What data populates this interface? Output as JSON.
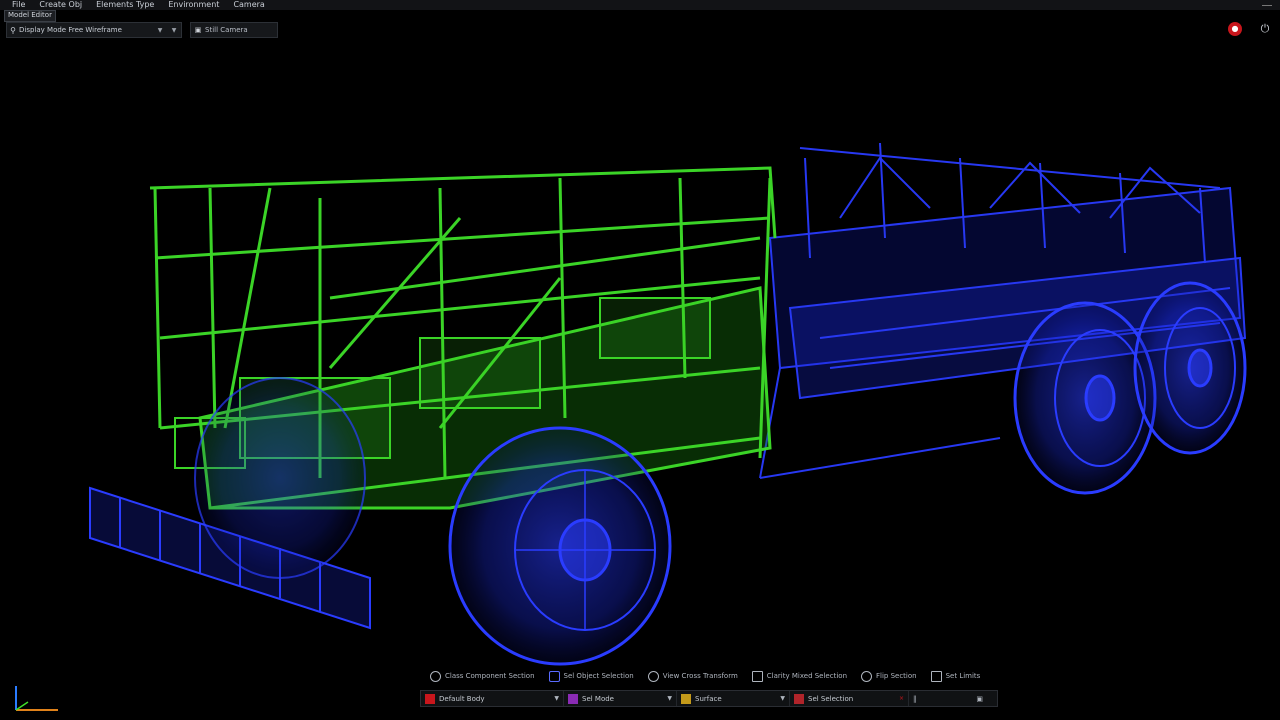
{
  "menubar": {
    "items": [
      "File",
      "Create Obj",
      "Elements Type",
      "Environment",
      "Camera"
    ]
  },
  "doc_tab": {
    "label": "Model Editor"
  },
  "toolbar": {
    "search_dropdown": "Display Mode Free Wireframe",
    "view_button": "Still Camera"
  },
  "colors": {
    "frame_green": "#3fe02a",
    "chassis_blue": "#2a3cff",
    "background": "#000000",
    "record_red": "#c8161c"
  },
  "mode_row": [
    {
      "icon": "circle-icon",
      "label": "Class Component Section"
    },
    {
      "icon": "layers-icon",
      "label": "Sel Object Selection"
    },
    {
      "icon": "circle-icon",
      "label": "View Cross Transform"
    },
    {
      "icon": "cube-icon",
      "label": "Clarity Mixed Selection"
    },
    {
      "icon": "circle-icon",
      "label": "Flip Section"
    },
    {
      "icon": "square-icon",
      "label": "Set Limits"
    }
  ],
  "bottom_bar": [
    {
      "label": "Default Body",
      "swatch": "#c8161c"
    },
    {
      "label": "Sel Mode",
      "swatch": "#8a2bb4"
    },
    {
      "label": "Surface",
      "swatch": "#c49a1a"
    },
    {
      "label": "Sel Selection",
      "swatch": "#b0242a"
    }
  ]
}
